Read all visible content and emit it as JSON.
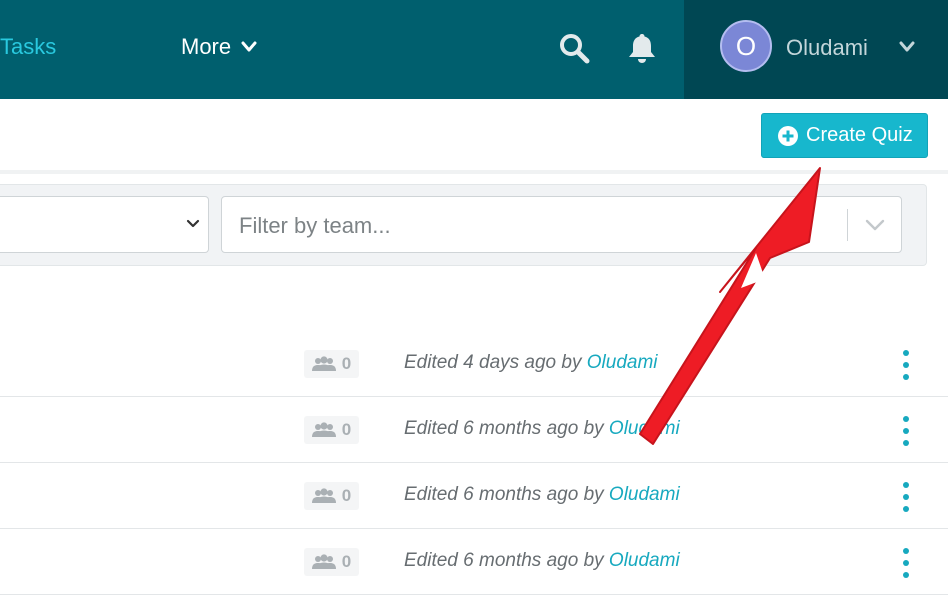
{
  "nav": {
    "tasks_label": "Tasks",
    "more_label": "More",
    "user_name": "Oludami",
    "avatar_initial": "O"
  },
  "toolbar": {
    "create_quiz_label": "Create Quiz"
  },
  "filters": {
    "team_placeholder": "Filter by team..."
  },
  "quiz_rows": [
    {
      "participants": "0",
      "edited_text": "Edited 4 days ago by ",
      "author": "Oludami"
    },
    {
      "participants": "0",
      "edited_text": "Edited 6 months ago by ",
      "author": "Oludami"
    },
    {
      "participants": "0",
      "edited_text": "Edited 6 months ago by ",
      "author": "Oludami"
    },
    {
      "participants": "0",
      "edited_text": "Edited 6 months ago by ",
      "author": "Oludami"
    }
  ],
  "icons": {
    "search": "search-icon",
    "bell": "bell-icon",
    "create": "plus-circle-icon",
    "users": "users-icon",
    "menu": "kebab-menu-icon"
  },
  "colors": {
    "topbar": "#005f6e",
    "user_area": "#004753",
    "accent": "#17b7cd",
    "link": "#17a9bf",
    "annotation_arrow": "#ee1c25"
  }
}
